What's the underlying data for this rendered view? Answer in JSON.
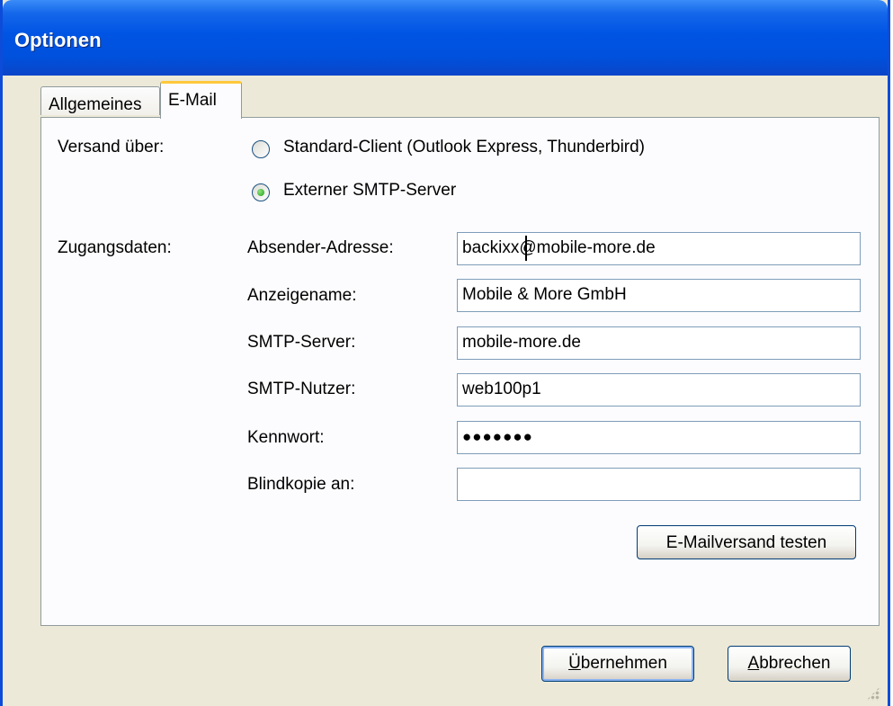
{
  "window": {
    "title": "Optionen"
  },
  "tabs": [
    {
      "label": "Allgemeines",
      "active": false
    },
    {
      "label": "E-Mail",
      "active": true
    }
  ],
  "versand": {
    "label": "Versand über:",
    "options": [
      {
        "label": "Standard-Client (Outlook Express, Thunderbird)",
        "selected": false
      },
      {
        "label": "Externer SMTP-Server",
        "selected": true
      }
    ]
  },
  "zugangsdaten": {
    "label": "Zugangsdaten:",
    "fields": [
      {
        "label": "Absender-Adresse:",
        "value": "backixx@mobile-more.de"
      },
      {
        "label": "Anzeigename:",
        "value": "Mobile & More GmbH"
      },
      {
        "label": "SMTP-Server:",
        "value": "mobile-more.de"
      },
      {
        "label": "SMTP-Nutzer:",
        "value": "web100p1"
      },
      {
        "label": "Kennwort:",
        "value": "●●●●●●●"
      },
      {
        "label": "Blindkopie an:",
        "value": ""
      }
    ]
  },
  "buttons": {
    "test": "E-Mailversand testen",
    "apply_first": "Ü",
    "apply_rest": "bernehmen",
    "cancel_first": "A",
    "cancel_rest": "bbrechen"
  },
  "colors": {
    "titlebar": "#0054e3",
    "dialog_bg": "#ece9d8",
    "active_tab_accent": "#ffc83c",
    "radio_selected": "#21a121"
  }
}
